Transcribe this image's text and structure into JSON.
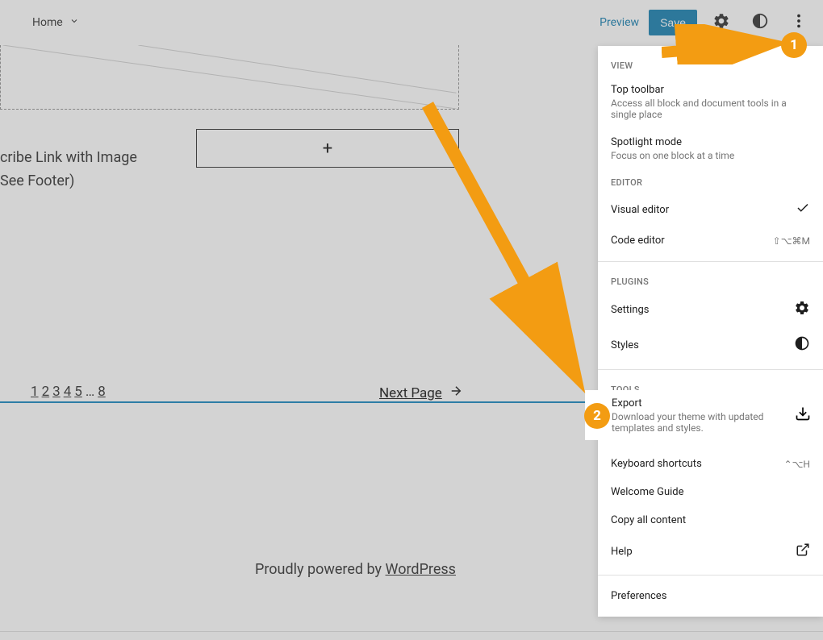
{
  "topbar": {
    "home": "Home",
    "preview": "Preview",
    "save": "Save"
  },
  "canvas": {
    "subscribe_line1": "cribe Link with Image",
    "subscribe_line2": "See Footer)",
    "pagination": [
      "1",
      "2",
      "3",
      "4",
      "5",
      "…",
      "8"
    ],
    "next_page": "Next Page",
    "footer_prefix": "Proudly powered by ",
    "footer_link": "WordPress"
  },
  "dropdown": {
    "view_header": "VIEW",
    "top_toolbar": "Top toolbar",
    "top_toolbar_desc": "Access all block and document tools in a single place",
    "spotlight": "Spotlight mode",
    "spotlight_desc": "Focus on one block at a time",
    "editor_header": "EDITOR",
    "visual_editor": "Visual editor",
    "code_editor": "Code editor",
    "code_shortcut": "⇧⌥⌘M",
    "plugins_header": "PLUGINS",
    "settings": "Settings",
    "styles": "Styles",
    "tools_header": "TOOLS",
    "export": "Export",
    "export_desc": "Download your theme with updated templates and styles.",
    "keyboard": "Keyboard shortcuts",
    "keyboard_shortcut": "⌃⌥H",
    "welcome": "Welcome Guide",
    "copy": "Copy all content",
    "help": "Help",
    "preferences": "Preferences"
  },
  "annotations": {
    "badge1": "1",
    "badge2": "2"
  }
}
